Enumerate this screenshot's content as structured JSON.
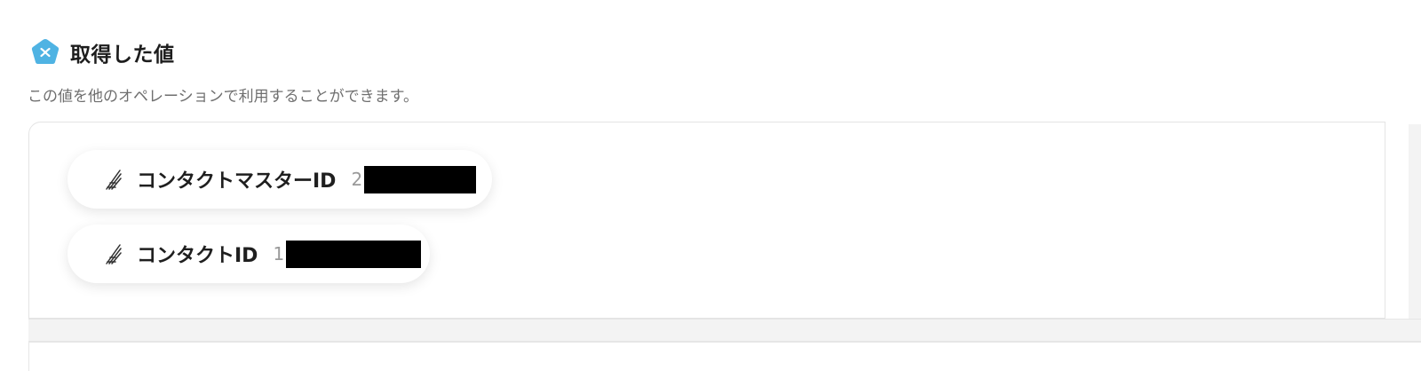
{
  "section": {
    "icon": "pentagon-x-icon",
    "title": "取得した値",
    "description": "この値を他のオペレーションで利用することができます。"
  },
  "values": [
    {
      "label": "コンタクトマスターID",
      "value_prefix": "2",
      "redacted": true,
      "icon": "feather-quill-icon"
    },
    {
      "label": "コンタクトID",
      "value_prefix": "1",
      "redacted": true,
      "icon": "feather-quill-icon"
    }
  ],
  "colors": {
    "accent": "#4fb3e3",
    "chip_bg": "#ffffff",
    "panel_border": "#e4e4e4",
    "muted_text": "#6f6f6f"
  }
}
